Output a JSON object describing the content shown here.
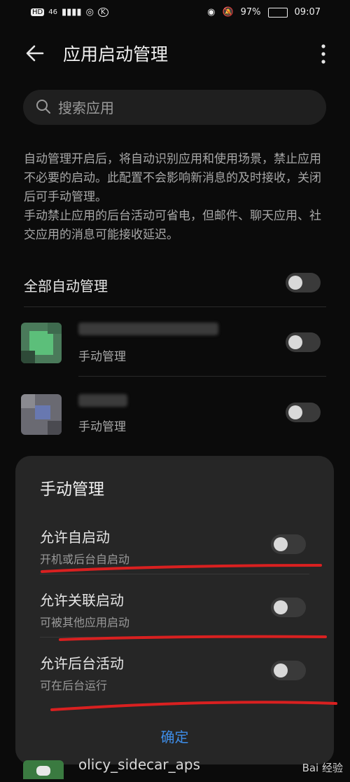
{
  "status_bar": {
    "left": [
      "HD",
      "46",
      "◎",
      "K"
    ],
    "battery": "97%",
    "time": "09:07"
  },
  "header": {
    "title": "应用启动管理"
  },
  "search": {
    "placeholder": "搜索应用"
  },
  "description": {
    "paragraph1": "自动管理开启后，将自动识别应用和使用场景，禁止应用不必要的启动。此配置不会影响新消息的及时接收，关闭后可手动管理。",
    "paragraph2": "手动禁止应用的后台活动可省电，但邮件、聊天应用、社交应用的消息可能接收延迟。"
  },
  "all_auto": {
    "label": "全部自动管理"
  },
  "apps": [
    {
      "status": "手动管理"
    },
    {
      "status": "手动管理"
    }
  ],
  "sheet": {
    "title": "手动管理",
    "options": [
      {
        "name": "允许自启动",
        "sub": "开机或后台自启动"
      },
      {
        "name": "允许关联启动",
        "sub": "可被其他应用启动"
      },
      {
        "name": "允许后台活动",
        "sub": "可在后台运行"
      }
    ],
    "confirm": "确定"
  },
  "bottom_app": {
    "name": "olicy_sidecar_aps"
  },
  "watermark": "Bai 经验",
  "colors": {
    "accent": "#3e8de8",
    "annotation": "#d92020"
  }
}
